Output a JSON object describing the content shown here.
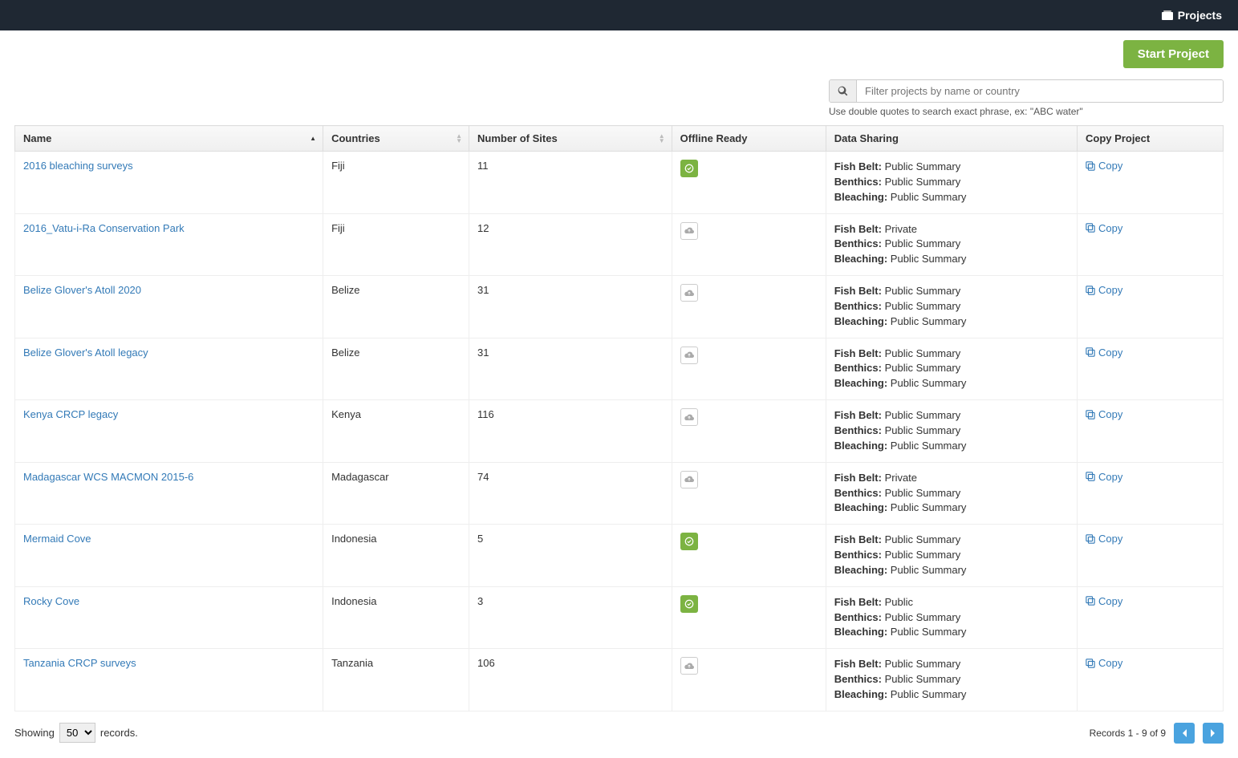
{
  "topnav": {
    "label": "Projects"
  },
  "actions": {
    "start_project": "Start Project"
  },
  "filter": {
    "placeholder": "Filter projects by name or country",
    "hint": "Use double quotes to search exact phrase, ex: \"ABC water\""
  },
  "columns": {
    "name": "Name",
    "countries": "Countries",
    "sites": "Number of Sites",
    "offline": "Offline Ready",
    "sharing": "Data Sharing",
    "copy": "Copy Project"
  },
  "sharing_labels": {
    "fish_belt": "Fish Belt:",
    "benthics": "Benthics:",
    "bleaching": "Bleaching:"
  },
  "copy_label": "Copy",
  "rows": [
    {
      "name": "2016 bleaching surveys",
      "countries": "Fiji",
      "sites": "11",
      "offline": true,
      "fish_belt": "Public Summary",
      "benthics": "Public Summary",
      "bleaching": "Public Summary"
    },
    {
      "name": "2016_Vatu-i-Ra Conservation Park",
      "countries": "Fiji",
      "sites": "12",
      "offline": false,
      "fish_belt": "Private",
      "benthics": "Public Summary",
      "bleaching": "Public Summary"
    },
    {
      "name": "Belize Glover's Atoll 2020",
      "countries": "Belize",
      "sites": "31",
      "offline": false,
      "fish_belt": "Public Summary",
      "benthics": "Public Summary",
      "bleaching": "Public Summary"
    },
    {
      "name": "Belize Glover's Atoll legacy",
      "countries": "Belize",
      "sites": "31",
      "offline": false,
      "fish_belt": "Public Summary",
      "benthics": "Public Summary",
      "bleaching": "Public Summary"
    },
    {
      "name": "Kenya CRCP legacy",
      "countries": "Kenya",
      "sites": "116",
      "offline": false,
      "fish_belt": "Public Summary",
      "benthics": "Public Summary",
      "bleaching": "Public Summary"
    },
    {
      "name": "Madagascar WCS MACMON 2015-6",
      "countries": "Madagascar",
      "sites": "74",
      "offline": false,
      "fish_belt": "Private",
      "benthics": "Public Summary",
      "bleaching": "Public Summary"
    },
    {
      "name": "Mermaid Cove",
      "countries": "Indonesia",
      "sites": "5",
      "offline": true,
      "fish_belt": "Public Summary",
      "benthics": "Public Summary",
      "bleaching": "Public Summary"
    },
    {
      "name": "Rocky Cove",
      "countries": "Indonesia",
      "sites": "3",
      "offline": true,
      "fish_belt": "Public",
      "benthics": "Public Summary",
      "bleaching": "Public Summary"
    },
    {
      "name": "Tanzania CRCP surveys",
      "countries": "Tanzania",
      "sites": "106",
      "offline": false,
      "fish_belt": "Public Summary",
      "benthics": "Public Summary",
      "bleaching": "Public Summary"
    }
  ],
  "footer": {
    "showing_prefix": "Showing",
    "showing_suffix": "records.",
    "page_size": "50",
    "records_summary": "Records 1 - 9 of 9"
  }
}
